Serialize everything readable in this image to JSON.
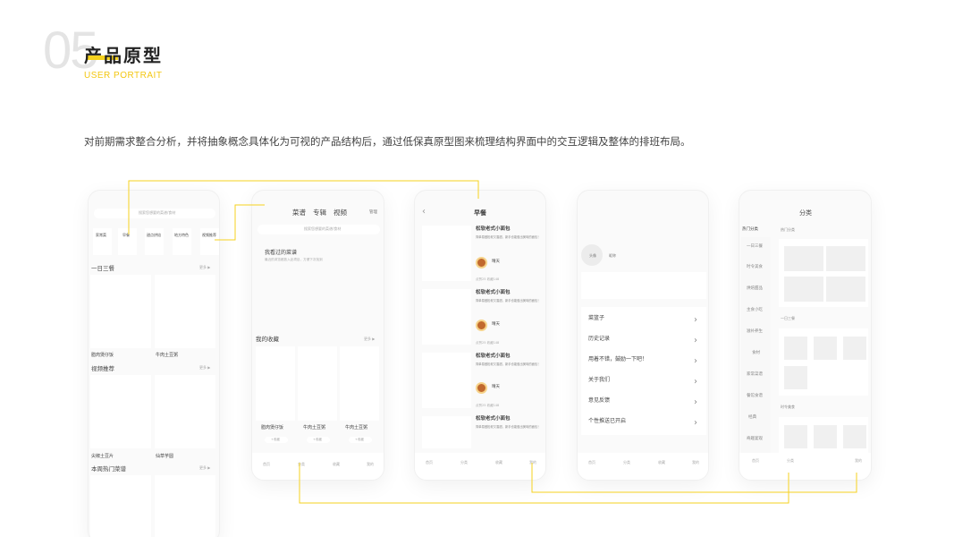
{
  "header": {
    "number": "05",
    "title": "产品原型",
    "subtitle": "USER PORTRAIT",
    "description": "对前期需求整合分析，并将抽象概念具体化为可视的产品结构后，通过低保真原型图来梳理结构界面中的交互逻辑及整体的排班布局。"
  },
  "colors": {
    "accent": "#f6d21f",
    "accent_text": "#f3c712"
  },
  "phone1": {
    "search_placeholder": "搜索您想要的菜谱/食材",
    "cats": [
      "家常菜",
      "早餐",
      "甜点烘焙",
      "地方特色",
      "视频推荐"
    ],
    "sec1": "一日三餐",
    "more": "更多 ▶",
    "dish1": "腊肉煲仔饭",
    "dish2": "牛肉土豆粥",
    "sec2": "视频推荐",
    "dish3": "尖椒土豆片",
    "dish4": "仙草芋圆",
    "sec3": "本周热门菜谱"
  },
  "phone2": {
    "tabs": [
      "菜谱",
      "专辑",
      "视频"
    ],
    "manage": "管理",
    "search_placeholder": "搜索您想要的菜谱/食材",
    "viewed": "我看过的菜谱",
    "viewed_hint": "最近的浏览都放入此项目，方便下次找到",
    "fav": "我的收藏",
    "more": "更多 ▶",
    "dish1": "腊肉煲仔饭",
    "dish2": "牛肉土豆粥",
    "dish3": "牛肉土豆粥",
    "btn": "+收藏",
    "nav": [
      "首页",
      "分类",
      "收藏",
      "我的"
    ]
  },
  "phone3": {
    "title": "早餐",
    "recipe_title": "松软老式小面包",
    "recipe_desc": "简单易做松软又香甜，新手也能做出美味的面包！",
    "author": "晴天",
    "stats": "点赞25  收藏148",
    "nav": [
      "首页",
      "分类",
      "收藏",
      "我的"
    ]
  },
  "phone4": {
    "login": "头像",
    "login2": "昵称",
    "menu": [
      "菜篮子",
      "历史记录",
      "用着不错，鼓励一下吧！",
      "关于我们",
      "意见反馈",
      "个性推送已开启"
    ],
    "nav": [
      "首页",
      "分类",
      "收藏",
      "我的"
    ]
  },
  "phone5": {
    "title": "分类",
    "hot": "热门分类",
    "hot_right": "热门分类",
    "cats": [
      "一日三餐",
      "时令美食",
      "烘焙甜品",
      "主食小吃",
      "滋补养生",
      "食材",
      "家常菜谱",
      "餐馆食谱",
      "经典",
      "奇趣宴观"
    ],
    "sub1": "一日三餐",
    "sub2": "时令美食",
    "nav": [
      "首页",
      "分类",
      "我的"
    ]
  }
}
